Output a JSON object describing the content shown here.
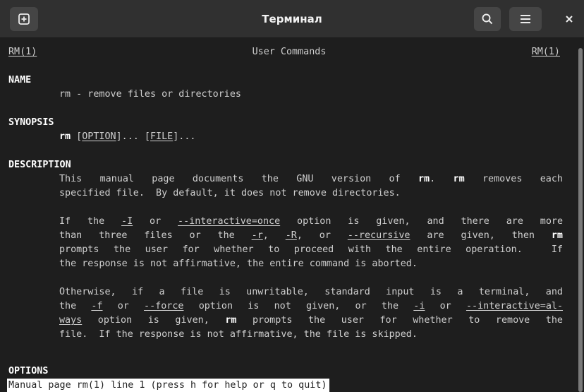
{
  "window": {
    "title": "Терминал",
    "icons": {
      "new_tab": "new-tab-icon",
      "search": "search-icon",
      "menu": "hamburger-menu-icon",
      "close": "close-icon"
    }
  },
  "terminal": {
    "header": {
      "left": "RM(1)",
      "center": "User Commands",
      "right": "RM(1)"
    },
    "name_heading": "NAME",
    "name_line": "rm - remove files or directories",
    "synopsis_heading": "SYNOPSIS",
    "synopsis": {
      "cmd": "rm",
      "option": "OPTION",
      "file": "FILE"
    },
    "description_heading": "DESCRIPTION",
    "options_heading": "OPTIONS",
    "status_line": "Manual page rm(1) line 1 (press h for help or q to quit)"
  },
  "colors": {
    "background": "#1e1e1e",
    "headerbar": "#303030",
    "text": "#cfcfcf",
    "bold": "#ffffff"
  }
}
